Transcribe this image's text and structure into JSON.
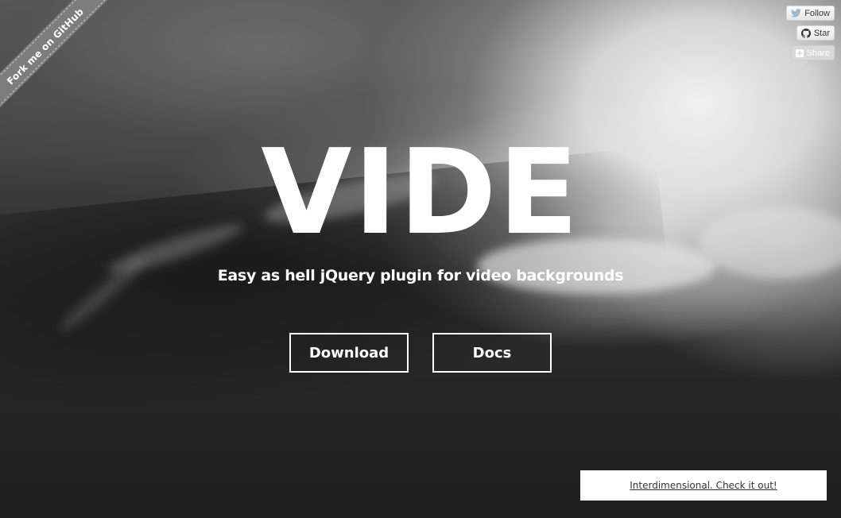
{
  "ribbon": {
    "label": "Fork me on GitHub"
  },
  "social": {
    "follow_label": "Follow",
    "star_label": "Star",
    "share_label": "Share"
  },
  "hero": {
    "title": "VIDE",
    "subtitle": "Easy as hell jQuery plugin for video backgrounds"
  },
  "actions": {
    "download_label": "Download",
    "docs_label": "Docs"
  },
  "promo": {
    "link_text": "Interdimensional. Check it out!"
  },
  "colors": {
    "text": "#ffffff",
    "ribbon": "#7d7d7d",
    "promo_bg": "#ffffff"
  }
}
